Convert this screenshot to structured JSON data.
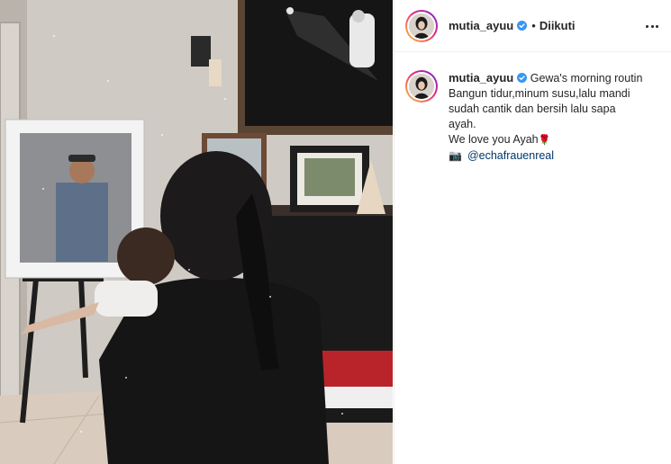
{
  "post": {
    "author": {
      "username": "mutia_ayuu",
      "verified": true,
      "follow_state": "Diikuti",
      "separator": "•"
    },
    "caption": {
      "lines": [
        "Gewa's morning routin",
        "Bangun tidur,minum susu,lalu mandi",
        "sudah cantik dan bersih lalu sapa",
        "ayah.",
        "We love you Ayah"
      ],
      "rose_emoji": "🌹",
      "camera_emoji": "📷",
      "credit_mention": "@echafrauenreal"
    }
  },
  "icons": {
    "verified": "verified-badge-icon",
    "more": "more-options-icon"
  },
  "colors": {
    "accent_blue": "#3897f0",
    "mention": "#00376b",
    "text": "#262626",
    "border": "#efefef"
  }
}
